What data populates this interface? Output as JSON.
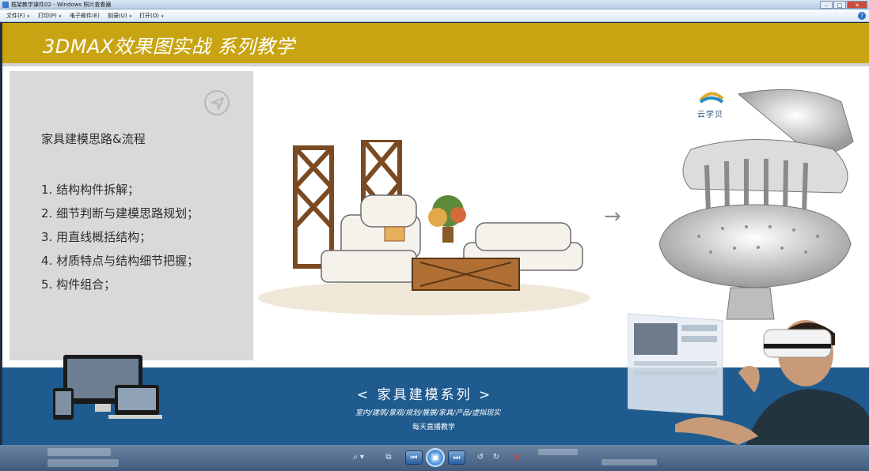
{
  "window": {
    "title": "框架教学课件02 - Windows 照片查看器",
    "minimize": "–",
    "maximize": "□",
    "close": "✕"
  },
  "menu": {
    "items": [
      {
        "label": "文件(F)"
      },
      {
        "label": "打印(P)"
      },
      {
        "label": "电子邮件(E)"
      },
      {
        "label": "刻录(U)"
      },
      {
        "label": "打开(O)"
      }
    ],
    "caret": "▾",
    "help": "?"
  },
  "slide": {
    "title": "3DMAX效果图实战  系列教学",
    "heading": "家具建模思路&流程",
    "steps": [
      "1.  结构构件拆解；",
      "2.  细节判断与建模思路规划；",
      "3.  用直线概括结构；",
      "4.  材质特点与结构细节把握；",
      "5.  构件组合；"
    ],
    "arrow": "→",
    "logo_text": "云学贝",
    "series_title": "<  家具建模系列  >",
    "series_sub": "室内/建筑/景观/规划/展展/家具/产品/虚拟现实",
    "series_daily": "每天直播教学"
  },
  "viewer": {
    "zoom": "⌕ ▾",
    "fit": "⧉",
    "prev": "⏮",
    "play": "▣",
    "next": "⏭",
    "rotate_ccw": "↺",
    "rotate_cw": "↻",
    "delete": "✕"
  },
  "colors": {
    "header_gold": "#c9a412",
    "footer_blue": "#1f5b8f",
    "panel_gray": "#d9d9d9"
  }
}
